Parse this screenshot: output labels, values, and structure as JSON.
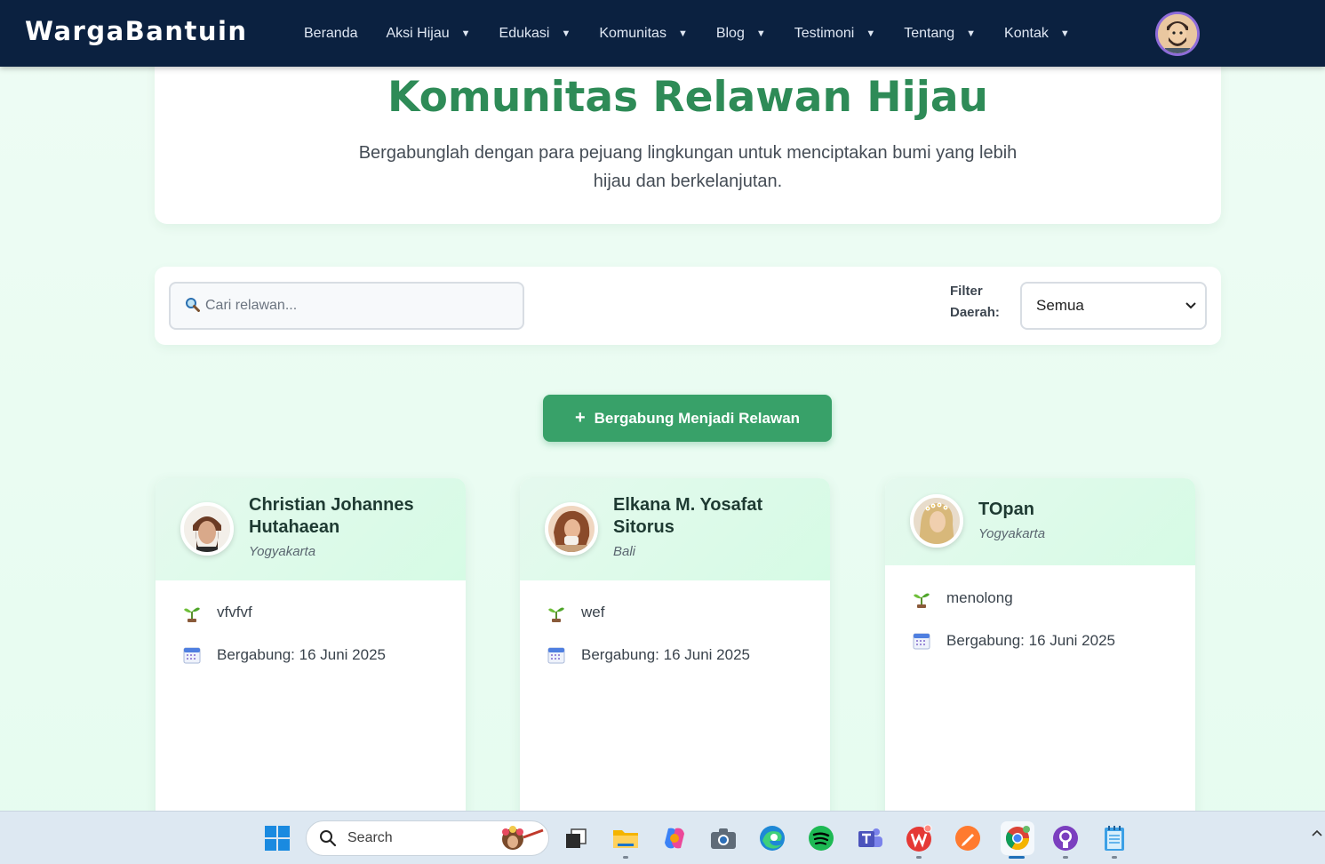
{
  "navbar": {
    "brand": "WargaBantuin",
    "items": [
      {
        "label": "Beranda",
        "caret": ""
      },
      {
        "label": "Aksi Hijau",
        "caret": "▼"
      },
      {
        "label": "Edukasi",
        "caret": "▼"
      },
      {
        "label": "Komunitas",
        "caret": "▼"
      },
      {
        "label": "Blog",
        "caret": "▼"
      },
      {
        "label": "Testimoni",
        "caret": "▼"
      },
      {
        "label": "Tentang",
        "caret": "▼"
      },
      {
        "label": "Kontak",
        "caret": "▼"
      }
    ]
  },
  "hero": {
    "title": "Komunitas Relawan Hijau",
    "subtitle": "Bergabunglah dengan para pejuang lingkungan untuk menciptakan bumi yang lebih hijau dan berkelanjutan."
  },
  "filter": {
    "search_placeholder": "Cari relawan...",
    "label": "Filter Daerah:",
    "selected": "Semua"
  },
  "join_button": {
    "plus": "+",
    "label": "Bergabung Menjadi Relawan"
  },
  "volunteers": [
    {
      "name": "Christian Johannes Hutahaean",
      "region": "Yogyakarta",
      "activity": "vfvfvf",
      "joined": "Bergabung: 16 Juni 2025"
    },
    {
      "name": "Elkana M. Yosafat Sitorus",
      "region": "Bali",
      "activity": "wef",
      "joined": "Bergabung: 16 Juni 2025"
    },
    {
      "name": "TOpan",
      "region": "Yogyakarta",
      "activity": "menolong",
      "joined": "Bergabung: 16 Juni 2025"
    }
  ],
  "taskbar": {
    "search_label": "Search"
  },
  "colors": {
    "navbar_bg": "#0b2140",
    "accent_green": "#2e8b57",
    "button_green": "#38a169",
    "page_bg": "#eefcf4"
  }
}
